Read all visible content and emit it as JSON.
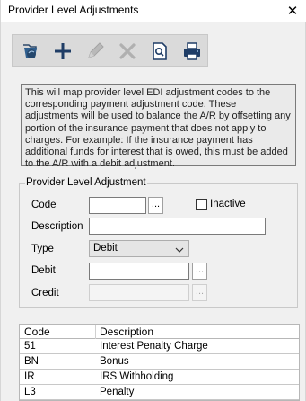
{
  "window": {
    "title": "Provider Level Adjustments",
    "close_glyph": "✕"
  },
  "toolbar": {
    "buttons": [
      {
        "name": "open-folder-icon"
      },
      {
        "name": "add-icon"
      },
      {
        "name": "edit-icon"
      },
      {
        "name": "delete-icon"
      },
      {
        "name": "preview-icon"
      },
      {
        "name": "print-icon"
      }
    ]
  },
  "info": {
    "text": "This will map provider level EDI adjustment codes to the corresponding payment adjustment code. These adjustments will be used to balance the A/R by offsetting any portion of the insurance payment that does not apply to charges. For example: If the insurance payment has additional funds for interest that is owed, this must be added to the A/R with a debit adjustment."
  },
  "form": {
    "group_title": "Provider Level Adjustment",
    "code_label": "Code",
    "code_value": "",
    "inactive_label": "Inactive",
    "description_label": "Description",
    "description_value": "",
    "type_label": "Type",
    "type_value": "Debit",
    "debit_label": "Debit",
    "debit_value": "",
    "credit_label": "Credit",
    "credit_value": "",
    "ellipsis": "..."
  },
  "grid": {
    "columns": [
      "Code",
      "Description"
    ],
    "rows": [
      {
        "code": "51",
        "description": "Interest Penalty Charge"
      },
      {
        "code": "BN",
        "description": "Bonus"
      },
      {
        "code": "IR",
        "description": "IRS Withholding"
      },
      {
        "code": "L3",
        "description": "Penalty"
      }
    ]
  }
}
